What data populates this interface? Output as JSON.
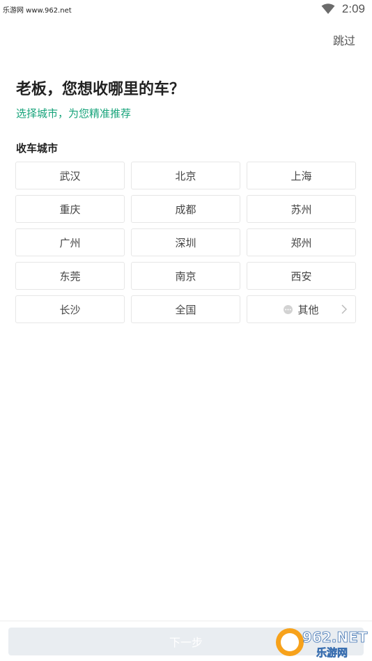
{
  "status_bar": {
    "watermark": "乐游网 www.962.net",
    "time": "2:09"
  },
  "header": {
    "skip_label": "跳过"
  },
  "main": {
    "title": "老板，您想收哪里的车？",
    "subtitle": "选择城市，为您精准推荐",
    "section_label": "收车城市",
    "cities": [
      "武汉",
      "北京",
      "上海",
      "重庆",
      "成都",
      "苏州",
      "广州",
      "深圳",
      "郑州",
      "东莞",
      "南京",
      "西安",
      "长沙",
      "全国"
    ],
    "other_label": "其他"
  },
  "footer": {
    "next_label": "下一步"
  },
  "logo": {
    "text_top": "962.NET",
    "text_bottom": "乐游网"
  },
  "colors": {
    "accent": "#16a37a",
    "button_disabled": "#e9edf1",
    "border": "#e6e6e6"
  }
}
